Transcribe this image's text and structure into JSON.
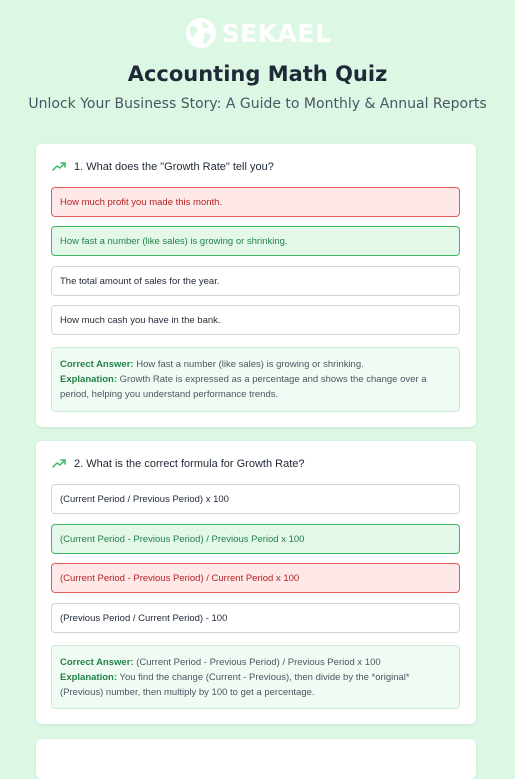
{
  "brand": {
    "name": "SEKAEL",
    "logo_icon": "globe-logo-icon",
    "accent": "#24814a"
  },
  "header": {
    "title": "Accounting Math Quiz",
    "subtitle": "Unlock Your Business Story: A Guide to Monthly & Annual Reports"
  },
  "questions": [
    {
      "icon": "trending-up-icon",
      "number": "1.",
      "text": "What does the \"Growth Rate\" tell you?",
      "options": [
        {
          "label": "How much profit you made this month.",
          "state": "wrong"
        },
        {
          "label": "How fast a number (like sales) is growing or shrinking.",
          "state": "correct"
        },
        {
          "label": "The total amount of sales for the year.",
          "state": "neutral"
        },
        {
          "label": "How much cash you have in the bank.",
          "state": "neutral"
        }
      ],
      "correct_label": "Correct Answer:",
      "correct_answer": "How fast a number (like sales) is growing or shrinking.",
      "explanation_label": "Explanation:",
      "explanation": "Growth Rate is expressed as a percentage and shows the change over a period, helping you understand performance trends."
    },
    {
      "icon": "trending-up-icon",
      "number": "2.",
      "text": "What is the correct formula for Growth Rate?",
      "options": [
        {
          "label": "(Current Period / Previous Period) x 100",
          "state": "neutral"
        },
        {
          "label": "(Current Period - Previous Period) / Previous Period x 100",
          "state": "correct"
        },
        {
          "label": "(Current Period - Previous Period) / Current Period x 100",
          "state": "wrong"
        },
        {
          "label": "(Previous Period / Current Period) - 100",
          "state": "neutral"
        }
      ],
      "correct_label": "Correct Answer:",
      "correct_answer": "(Current Period - Previous Period) / Previous Period x 100",
      "explanation_label": "Explanation:",
      "explanation": "You find the change (Current - Previous), then divide by the *original* (Previous) number, then multiply by 100 to get a percentage."
    }
  ],
  "colors": {
    "background": "#dcf8e4",
    "correct_bg": "#e4f8e9",
    "correct_border": "#3fb863",
    "wrong_bg": "#fee8e8",
    "wrong_border": "#e55a5a"
  }
}
